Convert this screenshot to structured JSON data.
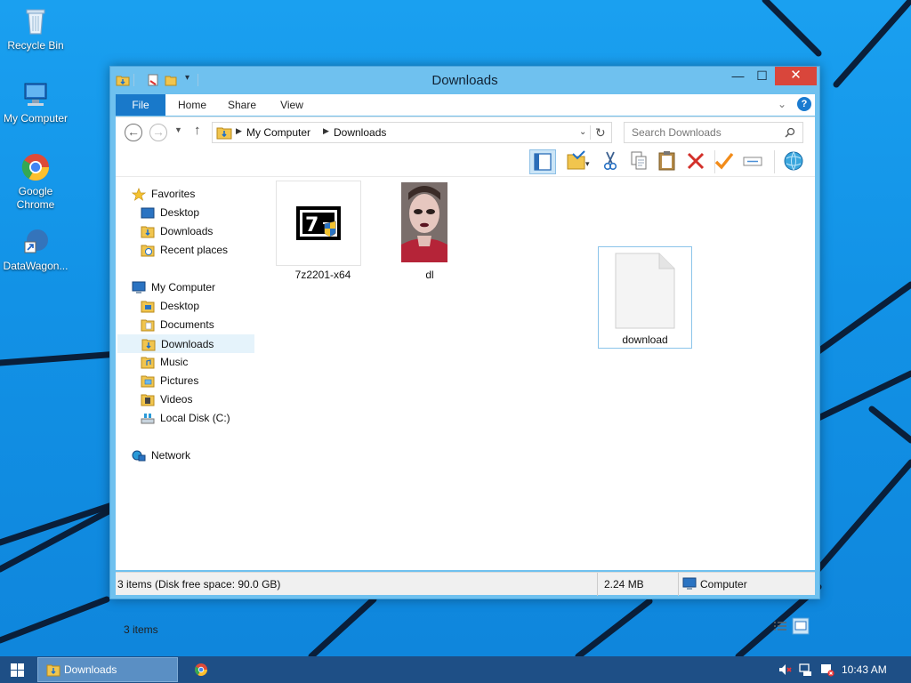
{
  "desktop": {
    "icons": [
      {
        "label": "Recycle Bin",
        "icon": "recycle-bin-icon"
      },
      {
        "label": "My Computer",
        "icon": "computer-icon"
      },
      {
        "label": "Google Chrome",
        "icon": "chrome-icon"
      },
      {
        "label": "DataWagon...",
        "icon": "shortcut-icon"
      }
    ]
  },
  "window": {
    "title": "Downloads",
    "controls": {
      "minimize": "—",
      "maximize": "☐",
      "close": "✕"
    },
    "ribbon_tabs": [
      "File",
      "Home",
      "Share",
      "View"
    ],
    "address": {
      "crumbs": [
        "My Computer",
        "Downloads"
      ]
    },
    "search": {
      "placeholder": "Search Downloads"
    },
    "nav_pane": {
      "favorites": {
        "label": "Favorites",
        "items": [
          "Desktop",
          "Downloads",
          "Recent places"
        ]
      },
      "computer": {
        "label": "My Computer",
        "items": [
          "Desktop",
          "Documents",
          "Downloads",
          "Music",
          "Pictures",
          "Videos",
          "Local Disk (C:)"
        ]
      },
      "network": {
        "label": "Network"
      },
      "selected": "Downloads"
    },
    "files": [
      {
        "name": "7z2201-x64",
        "type": "installer"
      },
      {
        "name": "dl",
        "type": "image"
      },
      {
        "name": "download",
        "type": "blank-file",
        "selected": true
      }
    ],
    "items_count": "3 items",
    "status": {
      "left": "3 items (Disk free space: 90.0 GB)",
      "size": "2.24 MB",
      "zone": "Computer"
    }
  },
  "taskbar": {
    "active_window": "Downloads",
    "clock": "10:43 AM"
  },
  "colors": {
    "accent": "#1979ca",
    "title_bar": "#6fc1ef",
    "close": "#d9463b",
    "taskbar": "#1e4f86"
  }
}
